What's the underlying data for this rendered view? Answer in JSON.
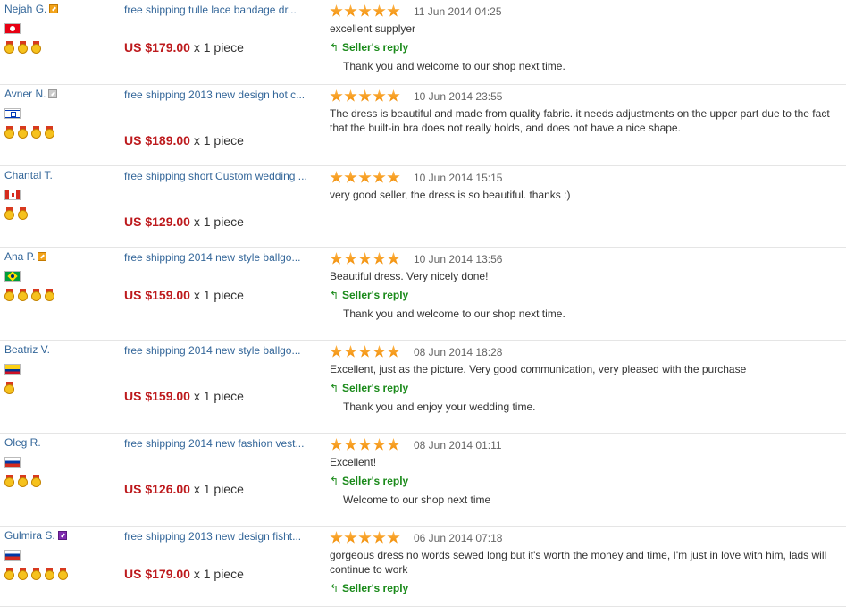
{
  "reviews": [
    {
      "buyer": "Nejah G.",
      "level_color": "orange",
      "flag": "tn",
      "medals": 3,
      "product": "free shipping tulle lace bandage dr...",
      "price": "US $179.00",
      "quantity": "x 1 piece",
      "stars": 5,
      "date": "11 Jun 2014 04:25",
      "comment": "excellent supplyer",
      "reply_label": "Seller's reply",
      "reply": "Thank you and welcome to our shop next time."
    },
    {
      "buyer": "Avner N.",
      "level_color": "gray",
      "flag": "il",
      "medals": 4,
      "product": "free shipping 2013 new design hot c...",
      "price": "US $189.00",
      "quantity": "x 1 piece",
      "stars": 5,
      "date": "10 Jun 2014 23:55",
      "comment": "The dress is beautiful and made from quality fabric. it needs adjustments on the upper part due to the fact that the built-in bra does not really holds, and does not have a nice shape.",
      "reply_label": "",
      "reply": ""
    },
    {
      "buyer": "Chantal T.",
      "level_color": "",
      "flag": "ca",
      "medals": 2,
      "product": "free shipping short Custom wedding ...",
      "price": "US $129.00",
      "quantity": "x 1 piece",
      "stars": 5,
      "date": "10 Jun 2014 15:15",
      "comment": "very good seller, the dress is so beautiful. thanks :)",
      "reply_label": "",
      "reply": ""
    },
    {
      "buyer": "Ana P.",
      "level_color": "orange",
      "flag": "br",
      "medals": 4,
      "product": "free shipping 2014 new style ballgo...",
      "price": "US $159.00",
      "quantity": "x 1 piece",
      "stars": 5,
      "date": "10 Jun 2014 13:56",
      "comment": "Beautiful dress. Very nicely done!",
      "reply_label": "Seller's reply",
      "reply": "Thank you and welcome to our shop next time."
    },
    {
      "buyer": "Beatriz V.",
      "level_color": "",
      "flag": "co",
      "medals": 1,
      "product": "free shipping 2014 new style ballgo...",
      "price": "US $159.00",
      "quantity": "x 1 piece",
      "stars": 5,
      "date": "08 Jun 2014 18:28",
      "comment": "Excellent, just as the picture. Very good communication, very pleased with the purchase",
      "reply_label": "Seller's reply",
      "reply": "Thank you and enjoy your wedding time."
    },
    {
      "buyer": "Oleg R.",
      "level_color": "",
      "flag": "ru",
      "medals": 3,
      "product": "free shipping 2014 new fashion vest...",
      "price": "US $126.00",
      "quantity": "x 1 piece",
      "stars": 5,
      "date": "08 Jun 2014 01:11",
      "comment": "Excellent!",
      "reply_label": "Seller's reply",
      "reply": "Welcome to our shop next time"
    },
    {
      "buyer": "Gulmira S.",
      "level_color": "purple",
      "flag": "kz",
      "medals": 5,
      "product": "free shipping 2013 new design fisht...",
      "price": "US $179.00",
      "quantity": "x 1 piece",
      "stars": 5,
      "date": "06 Jun 2014 07:18",
      "comment": "gorgeous dress no words sewed long but it's worth the money and time, I'm just in love with him, lads will continue to work",
      "reply_label": "Seller's reply",
      "reply": ""
    }
  ]
}
